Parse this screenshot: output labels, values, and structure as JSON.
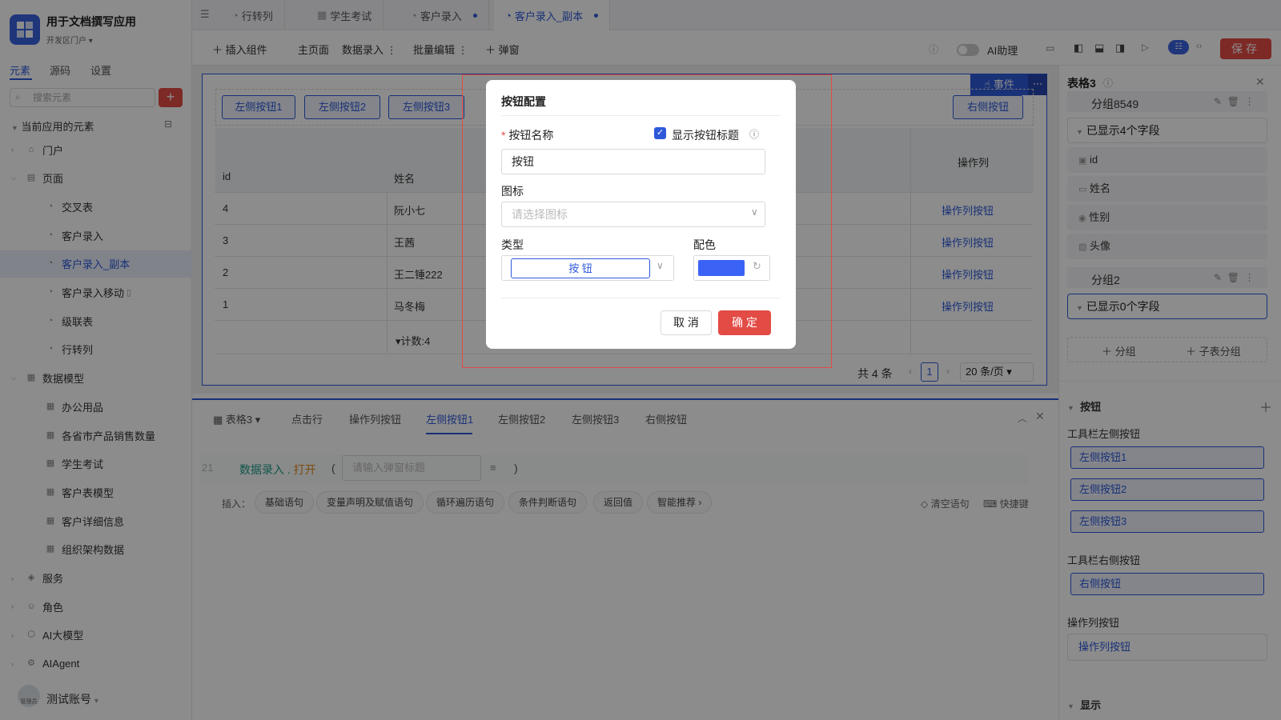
{
  "app": {
    "title": "用于文档撰写应用",
    "env": "开发区门户"
  },
  "sidebar": {
    "tabs": [
      "元素",
      "源码",
      "设置"
    ],
    "search_placeholder": "搜索元素",
    "section_title": "当前应用的元素",
    "items": [
      {
        "label": "门户",
        "level": 0
      },
      {
        "label": "页面",
        "level": 0
      },
      {
        "label": "交叉表",
        "level": 1
      },
      {
        "label": "客户录入",
        "level": 1
      },
      {
        "label": "客户录入_副本",
        "level": 1
      },
      {
        "label": "客户录入移动",
        "level": 1
      },
      {
        "label": "级联表",
        "level": 1
      },
      {
        "label": "行转列",
        "level": 1
      },
      {
        "label": "数据模型",
        "level": 0
      },
      {
        "label": "办公用品",
        "level": 1
      },
      {
        "label": "各省市产品销售数量",
        "level": 1
      },
      {
        "label": "学生考试",
        "level": 1
      },
      {
        "label": "客户表模型",
        "level": 1
      },
      {
        "label": "客户详细信息",
        "level": 1
      },
      {
        "label": "组织架构数据",
        "level": 1
      },
      {
        "label": "服务",
        "level": 0
      },
      {
        "label": "角色",
        "level": 0
      },
      {
        "label": "AI大模型",
        "level": 0
      },
      {
        "label": "AIAgent",
        "level": 0
      }
    ],
    "user": "测试账号",
    "avatar_label": "管理员"
  },
  "tabs": [
    "行转列",
    "学生考试",
    "客户录入",
    "客户录入_副本"
  ],
  "toolbar": {
    "insert": "插入组件",
    "home": "主页面",
    "data_entry": "数据录入",
    "batch_edit": "批量编辑",
    "popup": "弹窗",
    "ai": "AI助理",
    "save": "保存"
  },
  "canvas": {
    "event_label": "事件",
    "left_buttons": [
      "左侧按钮1",
      "左侧按钮2",
      "左侧按钮3"
    ],
    "right_button": "右侧按钮",
    "columns": [
      "id",
      "姓名",
      "操作列"
    ],
    "rows": [
      {
        "id": "4",
        "name": "阮小七",
        "op": "操作列按钮"
      },
      {
        "id": "3",
        "name": "王茜",
        "op": "操作列按钮"
      },
      {
        "id": "2",
        "name": "王二锤222",
        "op": "操作列按钮"
      },
      {
        "id": "1",
        "name": "马冬梅",
        "op": "操作列按钮"
      }
    ],
    "count_label": "计数:4",
    "total": "共 4 条",
    "page": "1",
    "page_size": "20 条/页"
  },
  "editor": {
    "tabs": [
      "表格3",
      "点击行",
      "操作列按钮",
      "左侧按钮1",
      "左侧按钮2",
      "左侧按钮3",
      "右侧按钮"
    ],
    "line_no": "21",
    "code_obj": "数据录入",
    "code_dot": ".",
    "code_fn": "打开",
    "paren_open": "(",
    "paren_close": ")",
    "placeholder": "请输入弹窗标题",
    "insert_label": "插入：",
    "chips": [
      "基础语句",
      "变量声明及赋值语句",
      "循环遍历语句",
      "条件判断语句",
      "返回值",
      "智能推荐"
    ],
    "clear": "清空语句",
    "shortcut": "快捷键"
  },
  "rpanel": {
    "title": "表格3",
    "group1": "分组8549",
    "shown4": "已显示4个字段",
    "fields": [
      "id",
      "姓名",
      "性别",
      "头像"
    ],
    "group2": "分组2",
    "shown0": "已显示0个字段",
    "add_group": "分组",
    "add_sub": "子表分组",
    "btn_section": "按钮",
    "left_label": "工具栏左侧按钮",
    "left_btns": [
      "左侧按钮1",
      "左侧按钮2",
      "左侧按钮3"
    ],
    "right_label": "工具栏右侧按钮",
    "right_btn": "右侧按钮",
    "op_label": "操作列按钮",
    "op_btn": "操作列按钮",
    "display": "显示"
  },
  "dialog": {
    "title": "按钮配置",
    "required_mark": "*",
    "name_label": "按钮名称",
    "show_title_label": "显示按钮标题",
    "name_value": "按钮",
    "icon_label": "图标",
    "icon_placeholder": "请选择图标",
    "type_label": "类型",
    "type_value": "按 钮",
    "color_label": "配色",
    "color_value": "#3a63f5",
    "cancel": "取 消",
    "confirm": "确 定"
  }
}
